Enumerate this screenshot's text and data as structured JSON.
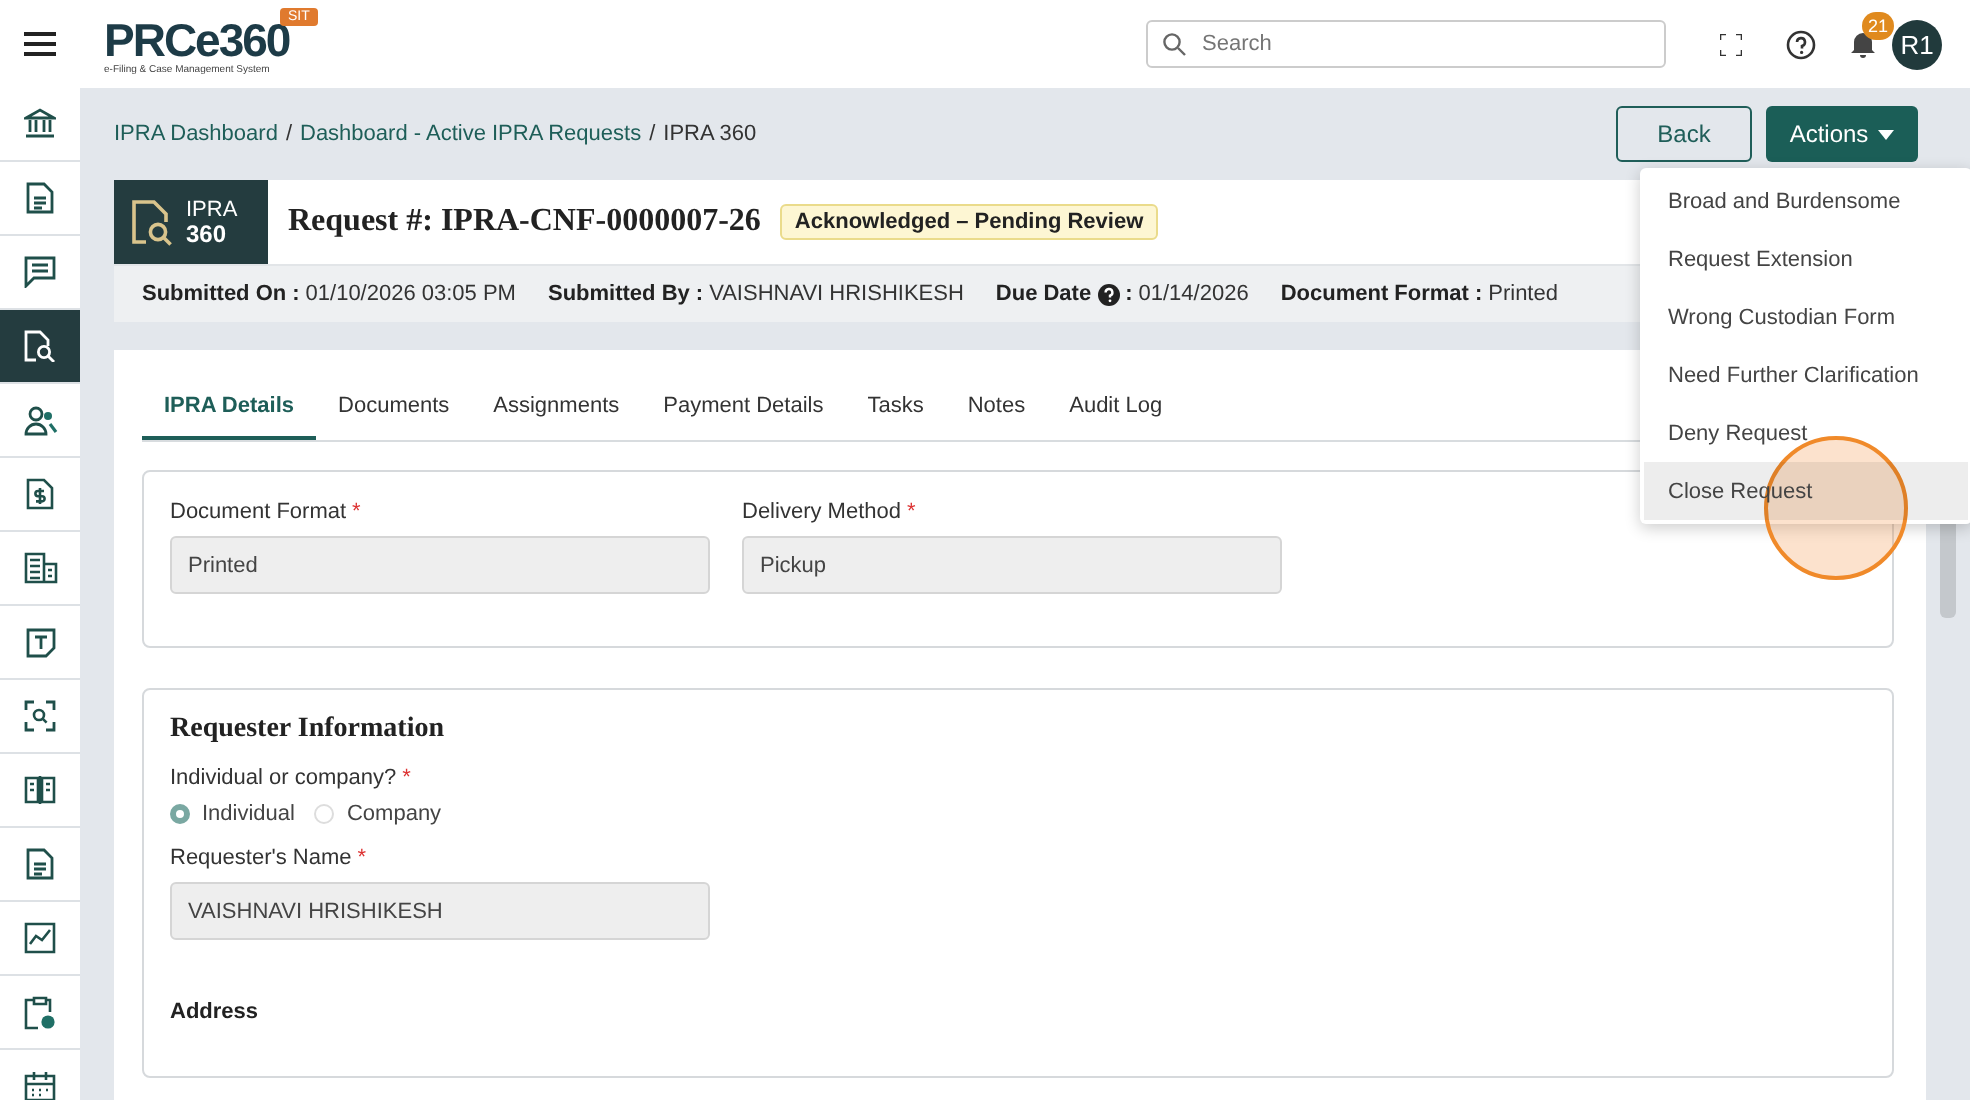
{
  "header": {
    "logo": "PRCe360",
    "logo_tagline": "e-Filing & Case Management System",
    "env_badge": "SIT",
    "search": {
      "placeholder": "Search"
    },
    "notification_count": "21",
    "avatar": "R1"
  },
  "sidebar": {
    "items": [
      {
        "kind": "bank",
        "selected": false
      },
      {
        "kind": "document",
        "selected": false
      },
      {
        "kind": "chat",
        "selected": false
      },
      {
        "kind": "doc-search",
        "selected": true
      },
      {
        "kind": "people",
        "selected": false
      },
      {
        "kind": "invoice",
        "selected": false
      },
      {
        "kind": "building",
        "selected": false
      },
      {
        "kind": "note",
        "selected": false
      },
      {
        "kind": "scan",
        "selected": false
      },
      {
        "kind": "book",
        "selected": false
      },
      {
        "kind": "document",
        "selected": false
      },
      {
        "kind": "chart",
        "selected": false
      },
      {
        "kind": "clipboard",
        "selected": false
      },
      {
        "kind": "calendar",
        "selected": false
      }
    ]
  },
  "breadcrumb": {
    "separator": "/",
    "items": [
      "IPRA Dashboard",
      "Dashboard - Active IPRA Requests",
      "IPRA 360"
    ]
  },
  "buttons": {
    "back": "Back",
    "actions": "Actions"
  },
  "actions_menu": {
    "items": [
      {
        "label": "Broad and Burdensome",
        "hovered": false
      },
      {
        "label": "Request Extension",
        "hovered": false
      },
      {
        "label": "Wrong Custodian Form",
        "hovered": false
      },
      {
        "label": "Need Further Clarification",
        "hovered": false
      },
      {
        "label": "Deny Request",
        "hovered": false
      },
      {
        "label": "Close Request",
        "hovered": true
      }
    ]
  },
  "request": {
    "badge_line1": "IPRA",
    "badge_line2": "360",
    "title": "Request #: IPRA-CNF-0000007-26",
    "status": "Acknowledged – Pending Review",
    "summary": [
      {
        "label": "Submitted On",
        "help": false,
        "separator": ":",
        "value": "01/10/2026 03:05 PM"
      },
      {
        "label": "Submitted By",
        "help": false,
        "separator": ":",
        "value": "VAISHNAVI HRISHIKESH"
      },
      {
        "label": "Due Date",
        "help": true,
        "separator": ":",
        "value": "01/14/2026"
      },
      {
        "label": "Document Format",
        "help": false,
        "separator": ":",
        "value": "Printed"
      }
    ]
  },
  "tabs": [
    {
      "label": "IPRA Details",
      "selected": true
    },
    {
      "label": "Documents",
      "selected": false
    },
    {
      "label": "Assignments",
      "selected": false
    },
    {
      "label": "Payment Details",
      "selected": false
    },
    {
      "label": "Tasks",
      "selected": false
    },
    {
      "label": "Notes",
      "selected": false
    },
    {
      "label": "Audit Log",
      "selected": false
    }
  ],
  "delivery_fields": [
    {
      "label": "Document Format",
      "required_mark": "*",
      "value": "Printed"
    },
    {
      "label": "Delivery Method",
      "required_mark": "*",
      "value": "Pickup"
    }
  ],
  "requester": {
    "title": "Requester Information",
    "question": {
      "label": "Individual or company?",
      "required_mark": "*",
      "options": [
        {
          "label": "Individual",
          "selected": true
        },
        {
          "label": "Company",
          "selected": false
        }
      ]
    },
    "name_field": {
      "label": "Requester's Name",
      "required_mark": "*",
      "value": "VAISHNAVI HRISHIKESH"
    },
    "address_heading": "Address"
  }
}
